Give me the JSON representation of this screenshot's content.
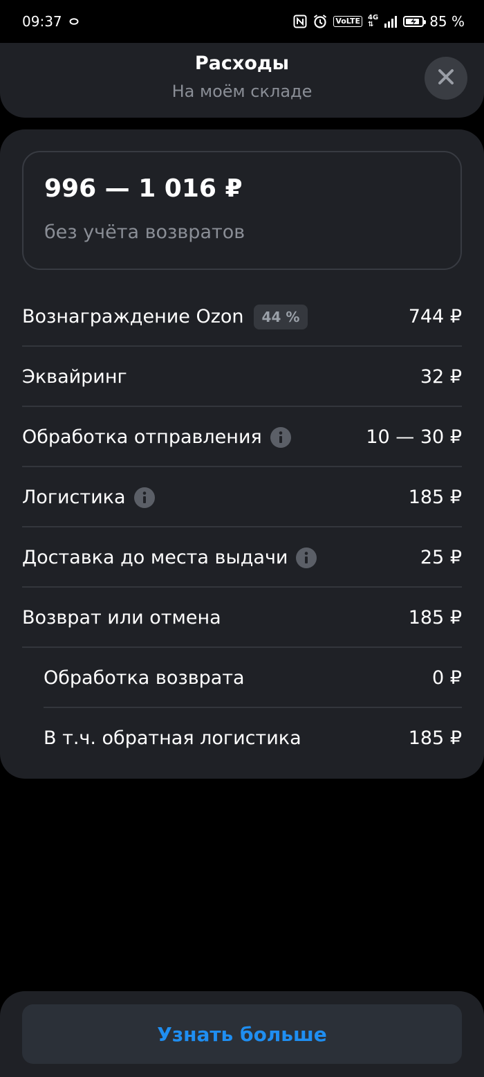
{
  "status_bar": {
    "time": "09:37",
    "battery_text": "85 %",
    "battery_level": 0.85,
    "icons": [
      "nfc-icon",
      "alarm-icon",
      "volte-icon",
      "signal-icon",
      "battery-icon"
    ],
    "volte_label": "VoLTE",
    "network_label": "4G"
  },
  "header": {
    "title": "Расходы",
    "subtitle": "На моём складе",
    "close_icon": "close-icon"
  },
  "summary": {
    "amount": "996 — 1 016 ₽",
    "note": "без учёта возвратов"
  },
  "rows": [
    {
      "label": "Вознаграждение Ozon",
      "badge": "44 %",
      "value": "744 ₽"
    },
    {
      "label": "Эквайринг",
      "value": "32 ₽"
    },
    {
      "label": "Обработка отправления",
      "info": true,
      "value": "10 — 30 ₽"
    },
    {
      "label": "Логистика",
      "info": true,
      "value": "185 ₽"
    },
    {
      "label": "Доставка до места выдачи",
      "info": true,
      "value": "25 ₽"
    },
    {
      "label": "Возврат или отмена",
      "value": "185 ₽"
    },
    {
      "label": "Обработка возврата",
      "value": "0 ₽"
    },
    {
      "label": "В т.ч. обратная логистика",
      "value": "185 ₽"
    }
  ],
  "footer": {
    "button_label": "Узнать больше"
  },
  "colors": {
    "background": "#000000",
    "surface": "#1f2126",
    "accent": "#1f8ef1",
    "muted_text": "#8a8e96"
  }
}
